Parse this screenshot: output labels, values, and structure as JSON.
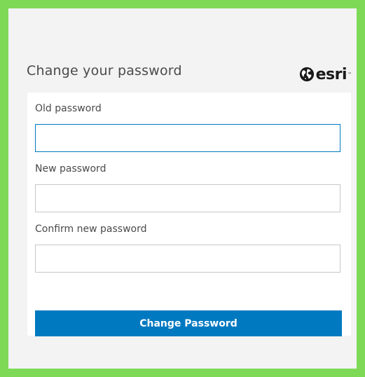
{
  "form": {
    "title": "Change your password",
    "old_password_label": "Old password",
    "old_password_value": "",
    "new_password_label": "New password",
    "new_password_value": "",
    "confirm_password_label": "Confirm new password",
    "confirm_password_value": "",
    "submit_label": "Change Password"
  },
  "logo": {
    "text": "esri",
    "trademark": "™",
    "icon": "globe-icon"
  },
  "colors": {
    "accent": "#0079c1",
    "outer_border": "#7ed957",
    "background": "#f3f3f3"
  }
}
